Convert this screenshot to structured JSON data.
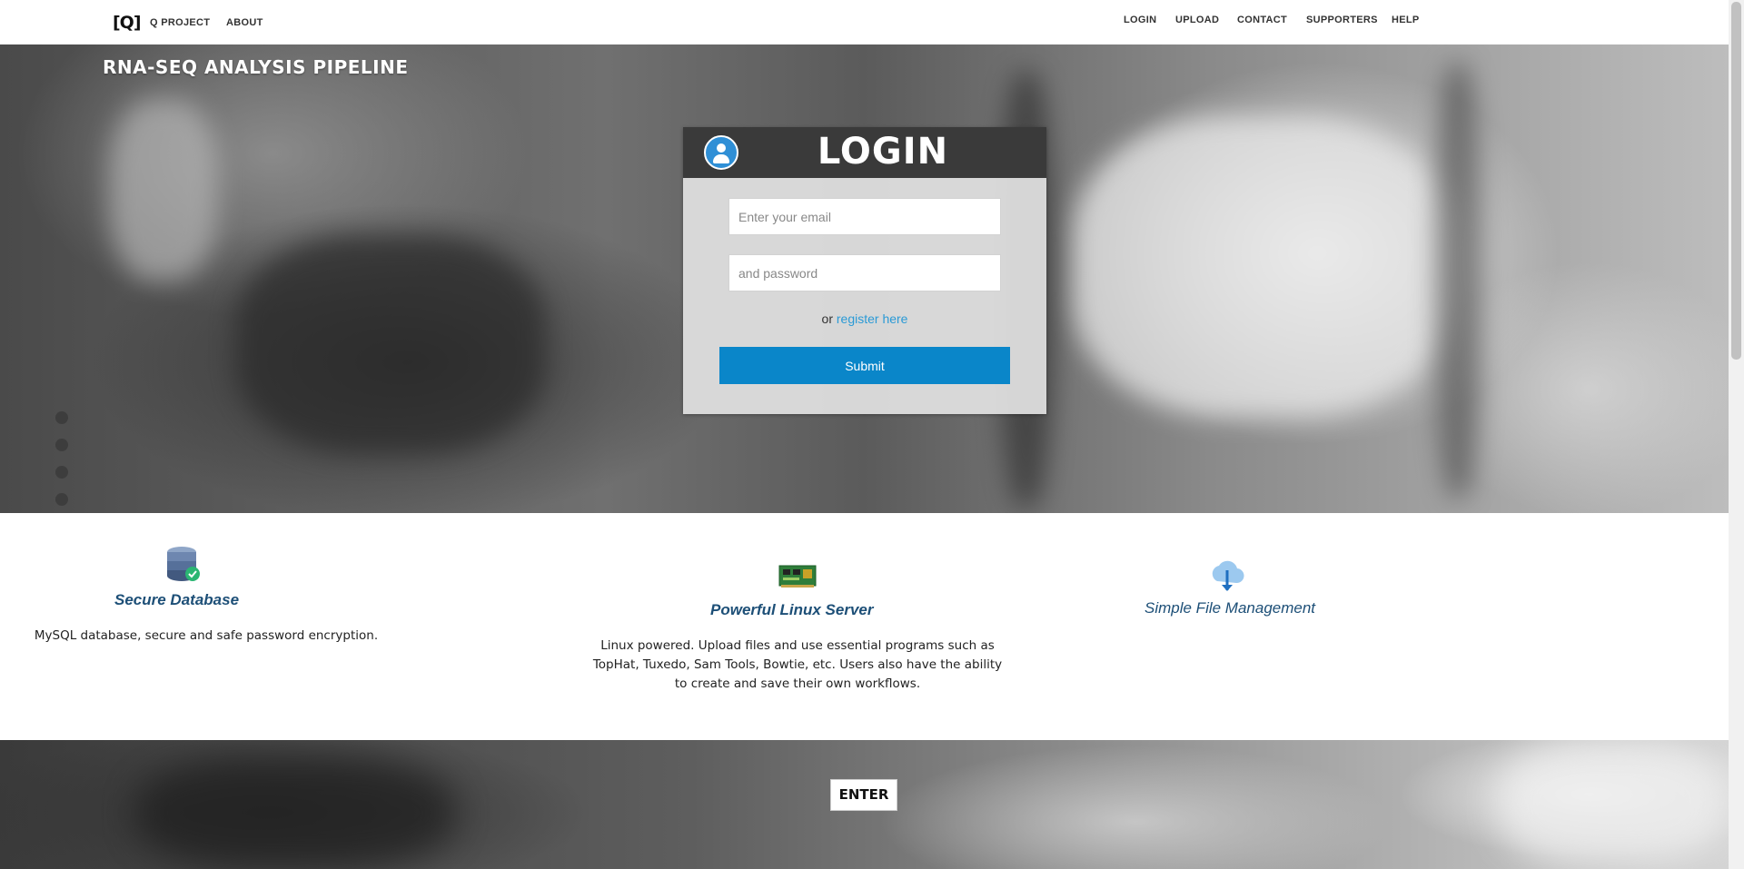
{
  "nav": {
    "logo": "[Q]",
    "left": [
      "Q PROJECT",
      "ABOUT"
    ],
    "right": [
      "LOGIN",
      "UPLOAD",
      "CONTACT",
      "SUPPORTERS",
      "HELP"
    ]
  },
  "hero": {
    "title": "RNA-SEQ ANALYSIS PIPELINE",
    "carousel_dots": 4
  },
  "login": {
    "title": "LOGIN",
    "email_placeholder": "Enter your email",
    "password_placeholder": "and password",
    "register_prefix": "or",
    "register_link": "register here",
    "submit_label": "Submit"
  },
  "features": [
    {
      "icon": "database-check-icon",
      "title": "Secure Database",
      "description": "MySQL database, secure and safe password encryption."
    },
    {
      "icon": "server-board-icon",
      "title": "Powerful Linux Server",
      "description": "Linux powered. Upload files and use essential programs such as TopHat, Tuxedo, Sam Tools, Bowtie, etc. Users also have the ability to create and save their own workflows."
    },
    {
      "icon": "cloud-download-icon",
      "title": "Simple File Management",
      "description": ""
    }
  ],
  "enter_label": "ENTER",
  "colors": {
    "accent": "#0a86c9",
    "link": "#2a9ad6",
    "feature_title": "#1d4f77",
    "login_header": "#3a3a3a"
  }
}
